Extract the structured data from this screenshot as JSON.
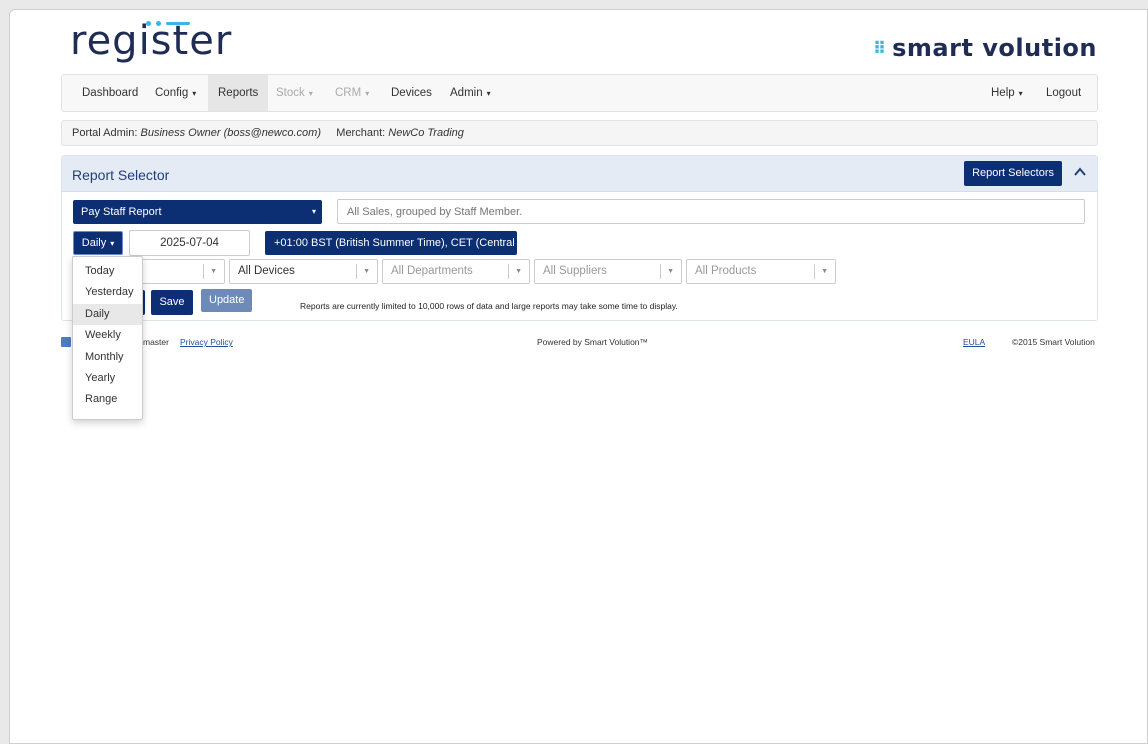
{
  "brand": {
    "logo_text": "register",
    "partner_logo_text": "smart volution"
  },
  "nav": {
    "items": [
      {
        "label": "Dashboard"
      },
      {
        "label": "Config",
        "caret": "▾"
      },
      {
        "label": "Reports"
      },
      {
        "label": "Stock",
        "caret": "▾"
      },
      {
        "label": "CRM",
        "caret": "▾"
      },
      {
        "label": "Devices"
      },
      {
        "label": "Admin",
        "caret": "▾"
      }
    ],
    "help": "Help",
    "logout": "Logout"
  },
  "userbar": {
    "admin_label": "Portal Admin:",
    "admin_value": "Business Owner (boss@newco.com)",
    "merchant_label": "Merchant:",
    "merchant_value": "NewCo Trading"
  },
  "panel": {
    "title": "Report Selector",
    "selectors_button": "Report Selectors"
  },
  "report": {
    "selected": "Pay Staff Report",
    "description_placeholder": "All Sales, grouped by Staff Member."
  },
  "period": {
    "selected": "Daily",
    "date": "2025-07-04",
    "timezone": "+01:00 BST (British Summer Time), CET (Central",
    "options": [
      "Today",
      "Yesterday",
      "Daily",
      "Weekly",
      "Monthly",
      "Yearly",
      "Range"
    ]
  },
  "filters": {
    "devices": "All Devices",
    "departments": "All Departments",
    "suppliers": "All Suppliers",
    "products": "All Products"
  },
  "actions": {
    "save": "Save",
    "update": "Update",
    "limit_note": "Reports are currently limited to 10,000 rows of data and large reports may take some time to display."
  },
  "footer": {
    "version": "master",
    "privacy": "Privacy Policy",
    "powered": "Powered by Smart Volution™",
    "eula": "EULA",
    "copyright": "©2015 Smart Volution"
  },
  "colors": {
    "primary": "#0c2e72",
    "accent": "#3cb5e5",
    "panel_head": "#e4ebf4"
  }
}
